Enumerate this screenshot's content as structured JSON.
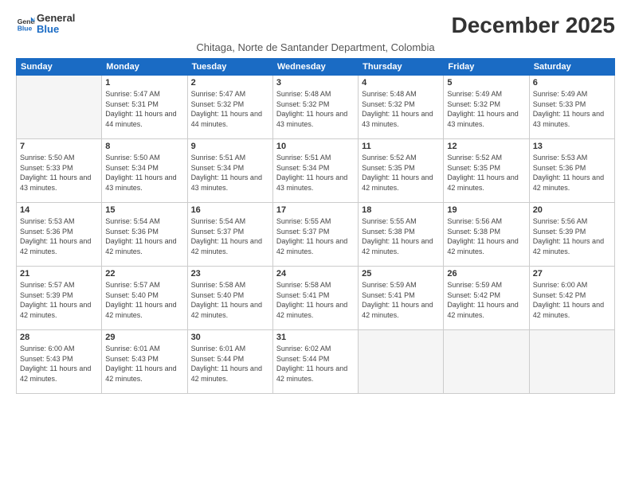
{
  "header": {
    "logo_line1": "General",
    "logo_line2": "Blue",
    "month_title": "December 2025",
    "subtitle": "Chitaga, Norte de Santander Department, Colombia"
  },
  "days_of_week": [
    "Sunday",
    "Monday",
    "Tuesday",
    "Wednesday",
    "Thursday",
    "Friday",
    "Saturday"
  ],
  "weeks": [
    [
      {
        "day": "",
        "sunrise": "",
        "sunset": "",
        "daylight": ""
      },
      {
        "day": "1",
        "sunrise": "Sunrise: 5:47 AM",
        "sunset": "Sunset: 5:31 PM",
        "daylight": "Daylight: 11 hours and 44 minutes."
      },
      {
        "day": "2",
        "sunrise": "Sunrise: 5:47 AM",
        "sunset": "Sunset: 5:32 PM",
        "daylight": "Daylight: 11 hours and 44 minutes."
      },
      {
        "day": "3",
        "sunrise": "Sunrise: 5:48 AM",
        "sunset": "Sunset: 5:32 PM",
        "daylight": "Daylight: 11 hours and 43 minutes."
      },
      {
        "day": "4",
        "sunrise": "Sunrise: 5:48 AM",
        "sunset": "Sunset: 5:32 PM",
        "daylight": "Daylight: 11 hours and 43 minutes."
      },
      {
        "day": "5",
        "sunrise": "Sunrise: 5:49 AM",
        "sunset": "Sunset: 5:32 PM",
        "daylight": "Daylight: 11 hours and 43 minutes."
      },
      {
        "day": "6",
        "sunrise": "Sunrise: 5:49 AM",
        "sunset": "Sunset: 5:33 PM",
        "daylight": "Daylight: 11 hours and 43 minutes."
      }
    ],
    [
      {
        "day": "7",
        "sunrise": "Sunrise: 5:50 AM",
        "sunset": "Sunset: 5:33 PM",
        "daylight": "Daylight: 11 hours and 43 minutes."
      },
      {
        "day": "8",
        "sunrise": "Sunrise: 5:50 AM",
        "sunset": "Sunset: 5:34 PM",
        "daylight": "Daylight: 11 hours and 43 minutes."
      },
      {
        "day": "9",
        "sunrise": "Sunrise: 5:51 AM",
        "sunset": "Sunset: 5:34 PM",
        "daylight": "Daylight: 11 hours and 43 minutes."
      },
      {
        "day": "10",
        "sunrise": "Sunrise: 5:51 AM",
        "sunset": "Sunset: 5:34 PM",
        "daylight": "Daylight: 11 hours and 43 minutes."
      },
      {
        "day": "11",
        "sunrise": "Sunrise: 5:52 AM",
        "sunset": "Sunset: 5:35 PM",
        "daylight": "Daylight: 11 hours and 42 minutes."
      },
      {
        "day": "12",
        "sunrise": "Sunrise: 5:52 AM",
        "sunset": "Sunset: 5:35 PM",
        "daylight": "Daylight: 11 hours and 42 minutes."
      },
      {
        "day": "13",
        "sunrise": "Sunrise: 5:53 AM",
        "sunset": "Sunset: 5:36 PM",
        "daylight": "Daylight: 11 hours and 42 minutes."
      }
    ],
    [
      {
        "day": "14",
        "sunrise": "Sunrise: 5:53 AM",
        "sunset": "Sunset: 5:36 PM",
        "daylight": "Daylight: 11 hours and 42 minutes."
      },
      {
        "day": "15",
        "sunrise": "Sunrise: 5:54 AM",
        "sunset": "Sunset: 5:36 PM",
        "daylight": "Daylight: 11 hours and 42 minutes."
      },
      {
        "day": "16",
        "sunrise": "Sunrise: 5:54 AM",
        "sunset": "Sunset: 5:37 PM",
        "daylight": "Daylight: 11 hours and 42 minutes."
      },
      {
        "day": "17",
        "sunrise": "Sunrise: 5:55 AM",
        "sunset": "Sunset: 5:37 PM",
        "daylight": "Daylight: 11 hours and 42 minutes."
      },
      {
        "day": "18",
        "sunrise": "Sunrise: 5:55 AM",
        "sunset": "Sunset: 5:38 PM",
        "daylight": "Daylight: 11 hours and 42 minutes."
      },
      {
        "day": "19",
        "sunrise": "Sunrise: 5:56 AM",
        "sunset": "Sunset: 5:38 PM",
        "daylight": "Daylight: 11 hours and 42 minutes."
      },
      {
        "day": "20",
        "sunrise": "Sunrise: 5:56 AM",
        "sunset": "Sunset: 5:39 PM",
        "daylight": "Daylight: 11 hours and 42 minutes."
      }
    ],
    [
      {
        "day": "21",
        "sunrise": "Sunrise: 5:57 AM",
        "sunset": "Sunset: 5:39 PM",
        "daylight": "Daylight: 11 hours and 42 minutes."
      },
      {
        "day": "22",
        "sunrise": "Sunrise: 5:57 AM",
        "sunset": "Sunset: 5:40 PM",
        "daylight": "Daylight: 11 hours and 42 minutes."
      },
      {
        "day": "23",
        "sunrise": "Sunrise: 5:58 AM",
        "sunset": "Sunset: 5:40 PM",
        "daylight": "Daylight: 11 hours and 42 minutes."
      },
      {
        "day": "24",
        "sunrise": "Sunrise: 5:58 AM",
        "sunset": "Sunset: 5:41 PM",
        "daylight": "Daylight: 11 hours and 42 minutes."
      },
      {
        "day": "25",
        "sunrise": "Sunrise: 5:59 AM",
        "sunset": "Sunset: 5:41 PM",
        "daylight": "Daylight: 11 hours and 42 minutes."
      },
      {
        "day": "26",
        "sunrise": "Sunrise: 5:59 AM",
        "sunset": "Sunset: 5:42 PM",
        "daylight": "Daylight: 11 hours and 42 minutes."
      },
      {
        "day": "27",
        "sunrise": "Sunrise: 6:00 AM",
        "sunset": "Sunset: 5:42 PM",
        "daylight": "Daylight: 11 hours and 42 minutes."
      }
    ],
    [
      {
        "day": "28",
        "sunrise": "Sunrise: 6:00 AM",
        "sunset": "Sunset: 5:43 PM",
        "daylight": "Daylight: 11 hours and 42 minutes."
      },
      {
        "day": "29",
        "sunrise": "Sunrise: 6:01 AM",
        "sunset": "Sunset: 5:43 PM",
        "daylight": "Daylight: 11 hours and 42 minutes."
      },
      {
        "day": "30",
        "sunrise": "Sunrise: 6:01 AM",
        "sunset": "Sunset: 5:44 PM",
        "daylight": "Daylight: 11 hours and 42 minutes."
      },
      {
        "day": "31",
        "sunrise": "Sunrise: 6:02 AM",
        "sunset": "Sunset: 5:44 PM",
        "daylight": "Daylight: 11 hours and 42 minutes."
      },
      {
        "day": "",
        "sunrise": "",
        "sunset": "",
        "daylight": ""
      },
      {
        "day": "",
        "sunrise": "",
        "sunset": "",
        "daylight": ""
      },
      {
        "day": "",
        "sunrise": "",
        "sunset": "",
        "daylight": ""
      }
    ]
  ]
}
